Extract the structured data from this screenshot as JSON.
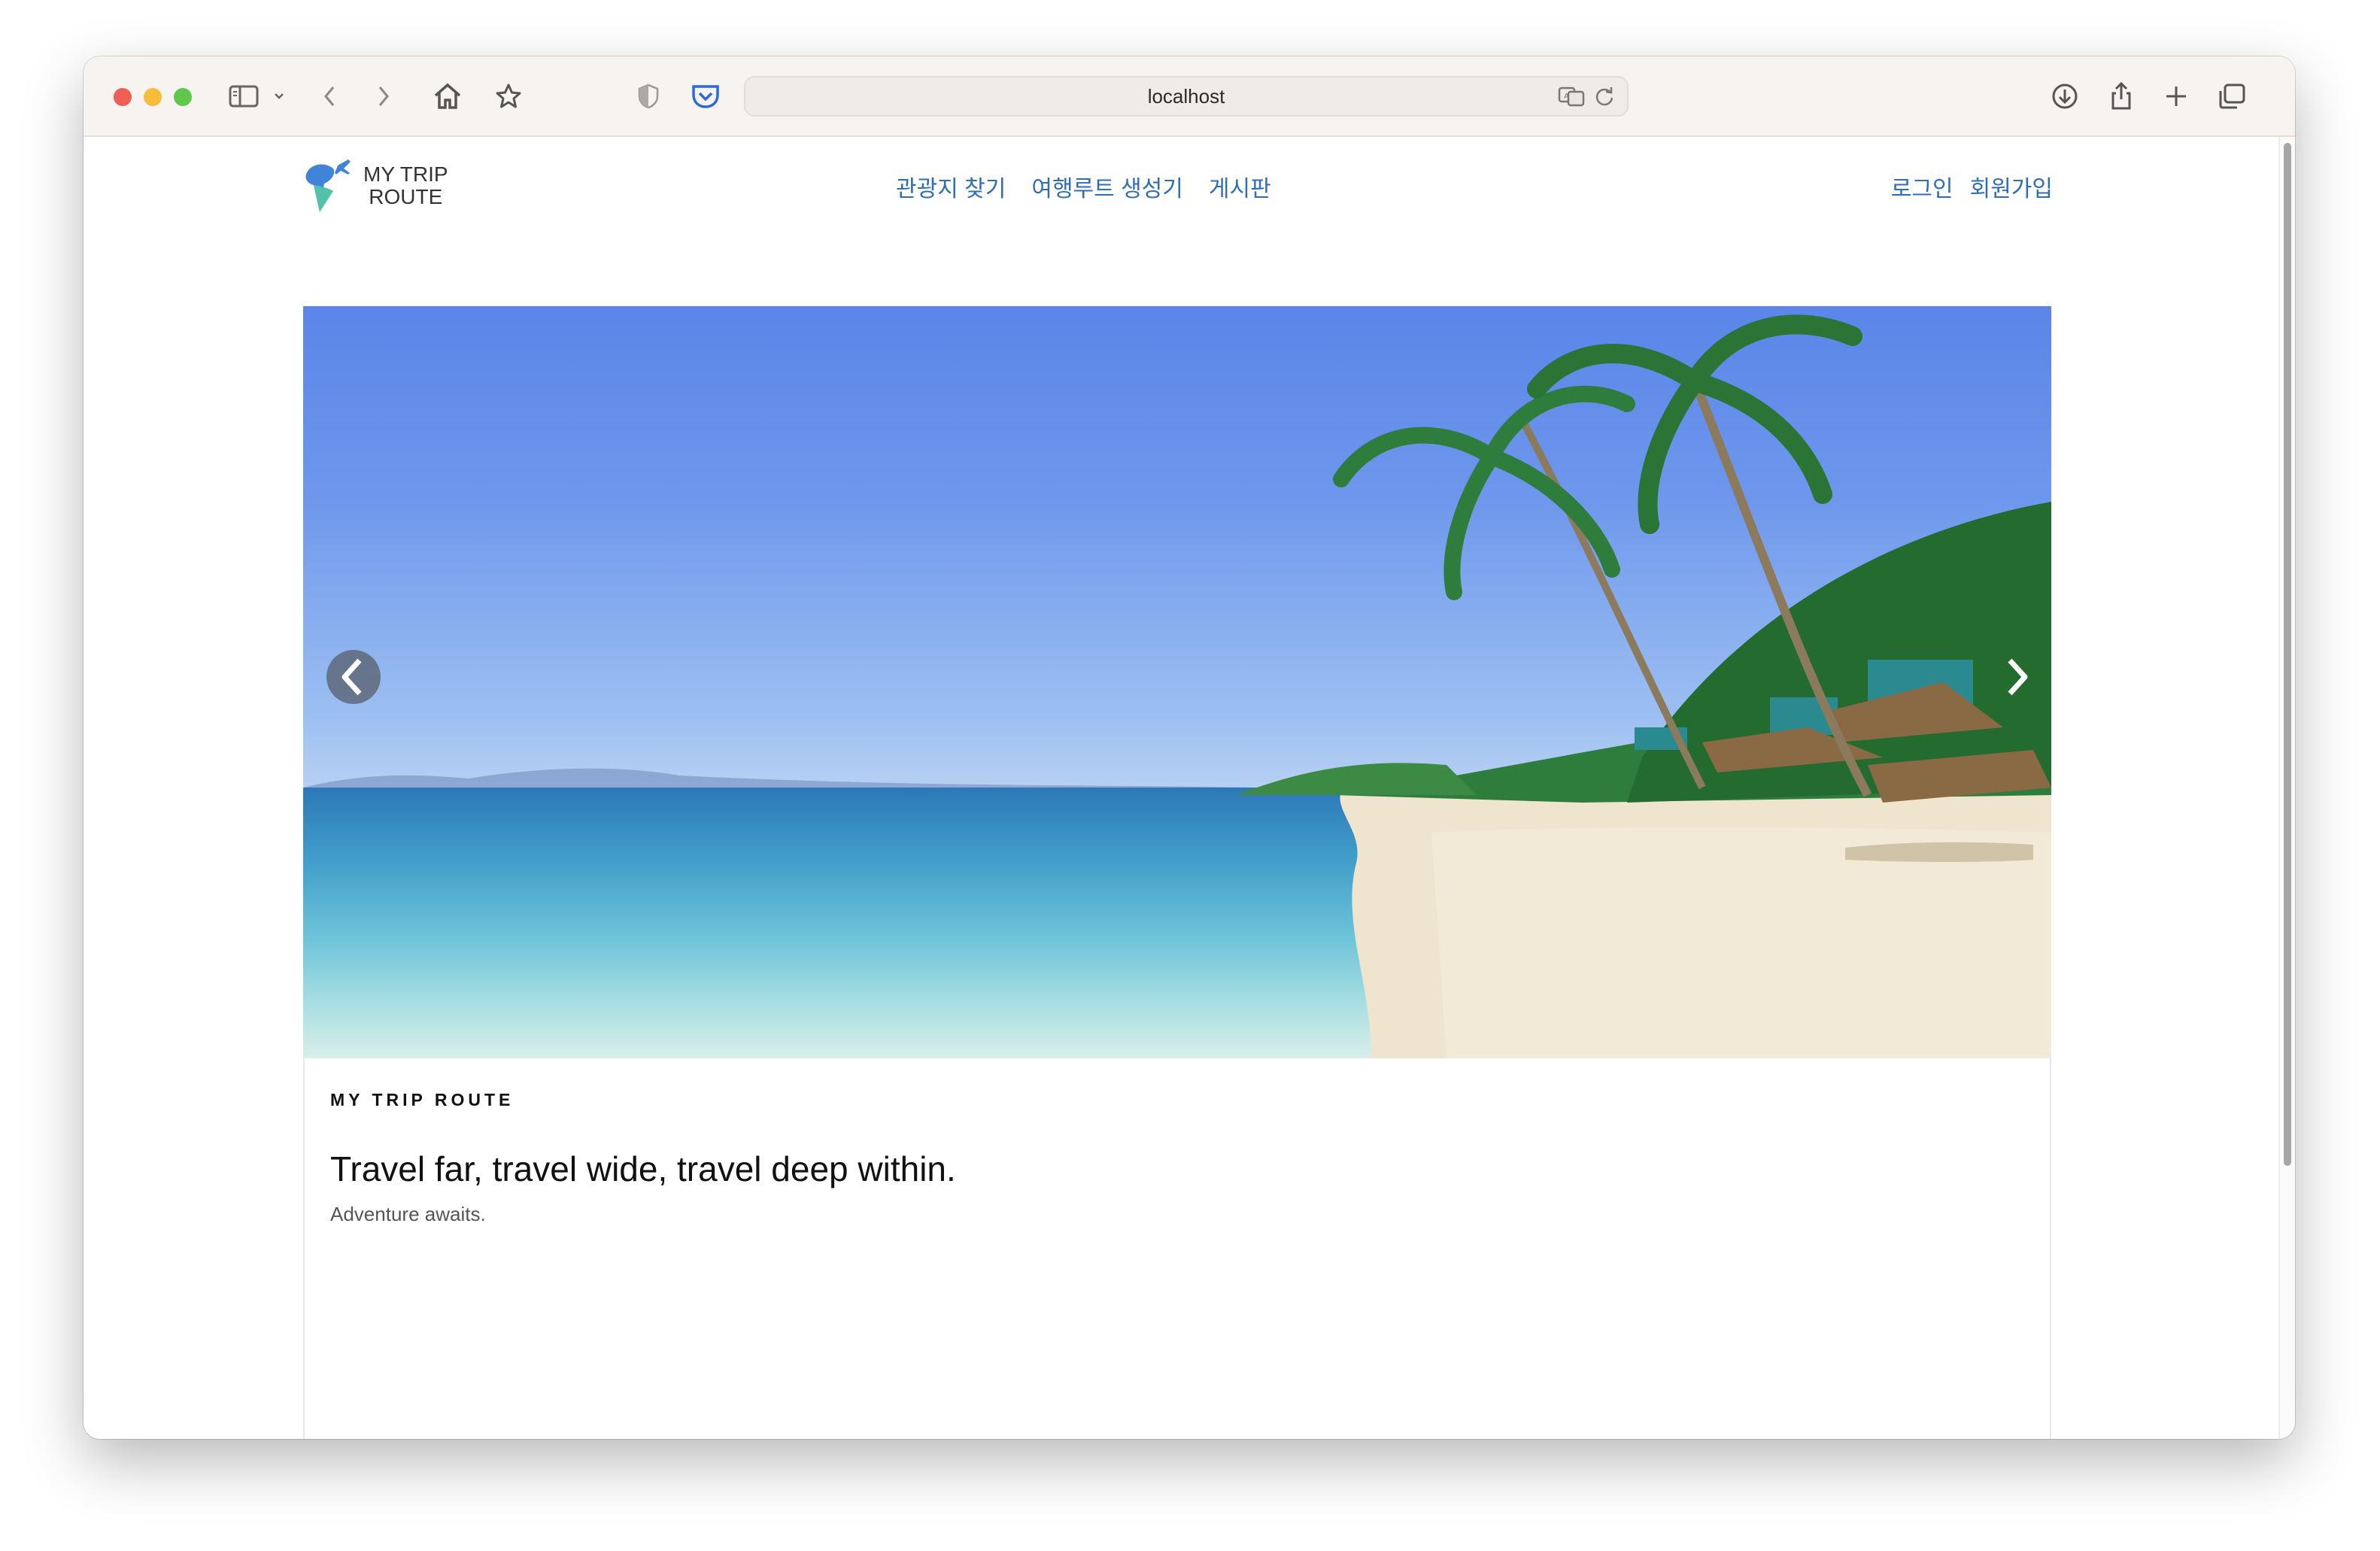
{
  "browser": {
    "url": "localhost",
    "icons": [
      "sidebar-icon",
      "chevron-down-icon",
      "back-icon",
      "forward-icon",
      "home-icon",
      "bookmark-star-icon",
      "privacy-shield-icon",
      "pocket-icon",
      "translate-icon",
      "reload-icon",
      "download-icon",
      "share-icon",
      "new-tab-icon",
      "tabs-overview-icon"
    ]
  },
  "site": {
    "logo": {
      "line1": "MY TRIP",
      "line2": "ROUTE"
    },
    "nav": [
      "관광지 찾기",
      "여행루트 생성기",
      "게시판"
    ],
    "auth": {
      "login": "로그인",
      "signup": "회원가입"
    },
    "accent_color": "#2f6db8"
  },
  "hero": {
    "eyebrow": "MY TRIP ROUTE",
    "headline": "Travel far, travel wide, travel deep within.",
    "subline": "Adventure awaits."
  }
}
